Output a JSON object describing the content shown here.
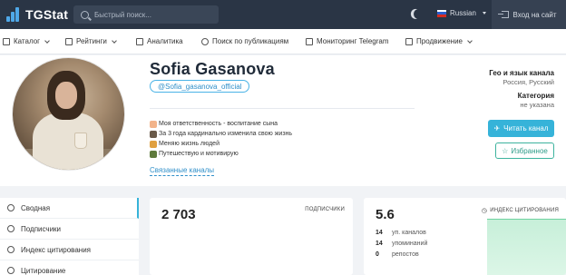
{
  "topbar": {
    "logo_text": "TGStat",
    "search_placeholder": "Быстрый поиск...",
    "language": "Russian",
    "login_label": "Вход на сайт"
  },
  "nav": {
    "items": [
      {
        "label": "Каталог",
        "icon": "grid-icon"
      },
      {
        "label": "Рейтинги",
        "icon": "trophy-icon"
      },
      {
        "label": "Аналитика",
        "icon": "chart-icon"
      },
      {
        "label": "Поиск по публикациям",
        "icon": "search-icon"
      },
      {
        "label": "Мониторинг Telegram",
        "icon": "monitor-icon"
      },
      {
        "label": "Продвижение",
        "icon": "megaphone-icon"
      }
    ]
  },
  "profile": {
    "name": "Sofia Gasanova",
    "username": "@Sofia_gasanova_official",
    "description": [
      "Моя ответственность - воспитание сына",
      "За 3 года кардинально изменила свою жизнь",
      "Меняю жизнь людей",
      "Путешествую и мотивирую"
    ],
    "related_link": "Связанные каналы",
    "geo_label": "Гео и язык канала",
    "geo_value": "Россия, Русский",
    "category_label": "Категория",
    "category_value": "не указана",
    "read_button": "Читать канал",
    "fav_button": "Избранное"
  },
  "sidebar": {
    "items": [
      "Сводная",
      "Подписчики",
      "Индекс цитирования",
      "Цитирование"
    ]
  },
  "stats": {
    "subscribers_value": "2 703",
    "subscribers_label": "ПОДПИСЧИКИ",
    "citation_value": "5.6",
    "citation_label": "ИНДЕКС ЦИТИРОВАНИЯ",
    "rows": [
      {
        "num": "14",
        "label": "уп. каналов"
      },
      {
        "num": "14",
        "label": "упоминаний"
      },
      {
        "num": "0",
        "label": "репостов"
      }
    ]
  },
  "colors": {
    "topbar": "#2a3545",
    "accent": "#36b3d9",
    "fav": "#3db39e"
  }
}
